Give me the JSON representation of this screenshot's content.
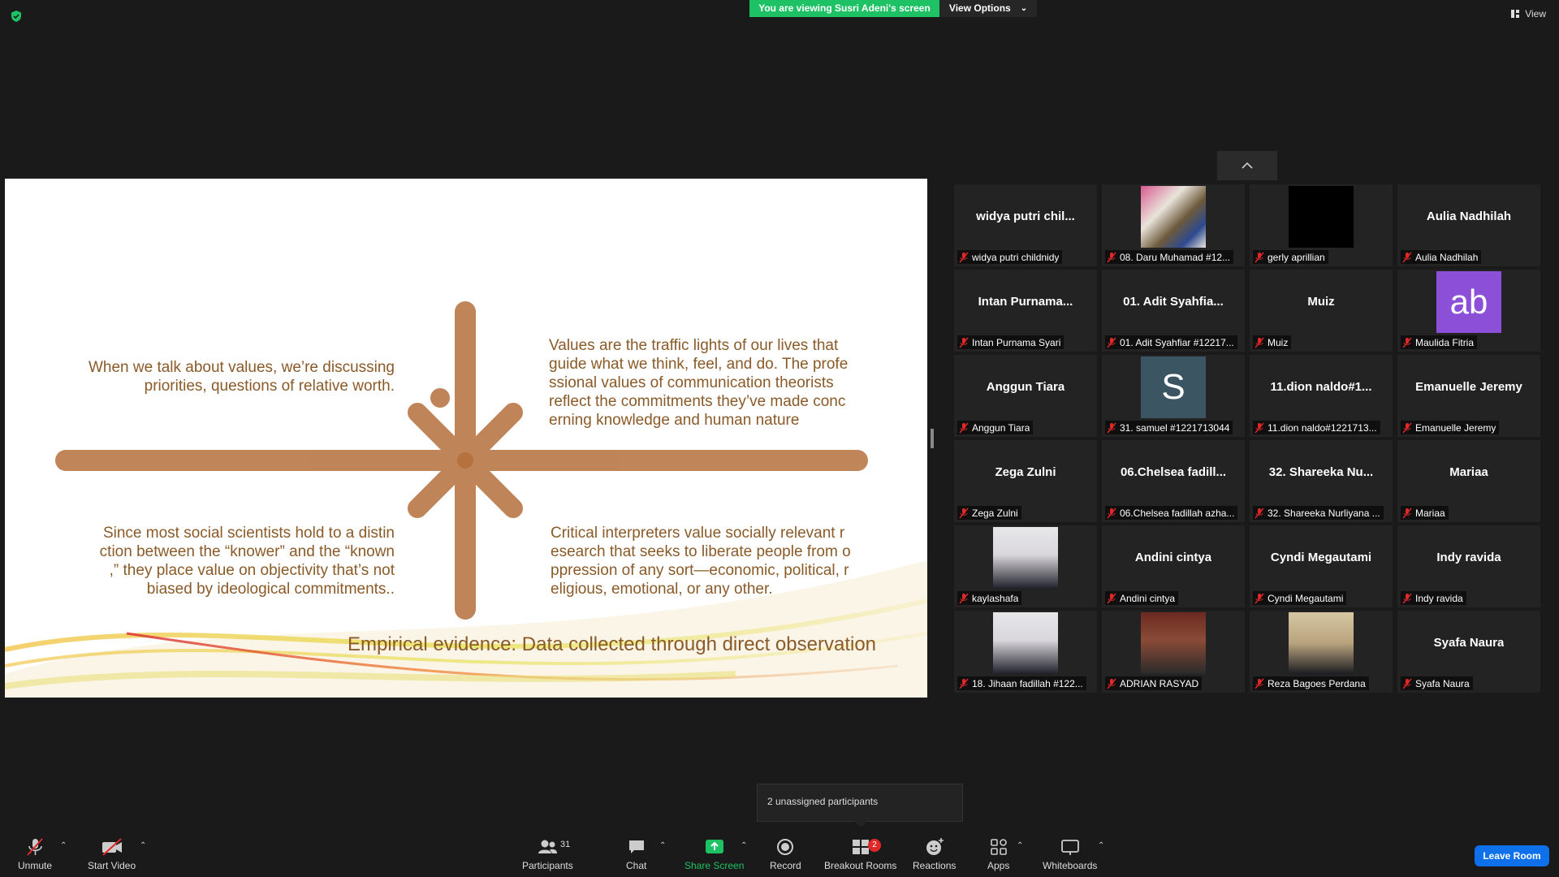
{
  "top_bar": {
    "banner": "You are viewing Susri Adeni's screen",
    "view_options": "View Options",
    "view": "View"
  },
  "slide": {
    "quadrant_top_left": "When we talk about values, we’re discussing priorities, questions of relative worth.",
    "quadrant_top_right": "Values are the traffic lights of our lives that guide what we think, feel, and do. The profe ssional values of communication theorists reflect the commitments they’ve made conc erning knowledge and human nature",
    "quadrant_bottom_left": "Since most social scientists hold to a distin ction between the “knower” and the “known ,” they place value on objectivity that’s not biased by ideological commitments..",
    "quadrant_bottom_right": "Critical interpreters value socially relevant r esearch that seeks to liberate people from o ppression of any sort—economic, political, r eligious, emotional, or any other.",
    "footer": "Empirical evidence: Data collected through direct observation",
    "accent_color": "#b5703c"
  },
  "gallery": {
    "tiles": [
      {
        "big": "widya  putri  chil...",
        "label": "widya putri childnidy"
      },
      {
        "big": "",
        "label": "08. Daru Muhamad #12..."
      },
      {
        "big": "",
        "label": "gerly aprillian"
      },
      {
        "big": "Aulia Nadhilah",
        "label": "Aulia Nadhilah"
      },
      {
        "big": "Intan  Purnama...",
        "label": "Intan Purnama Syari"
      },
      {
        "big": "01.  Adit  Syahfia...",
        "label": "01. Adit Syahfiar #12217..."
      },
      {
        "big": "Muiz",
        "label": "Muiz"
      },
      {
        "big": "ab",
        "label": "Maulida Fitria"
      },
      {
        "big": "Anggun Tiara",
        "label": "Anggun Tiara"
      },
      {
        "big": "S",
        "label": "31. samuel #1221713044"
      },
      {
        "big": "11.dion  naldo#1...",
        "label": "11.dion naldo#1221713..."
      },
      {
        "big": "Emanuelle Jeremy",
        "label": "Emanuelle Jeremy"
      },
      {
        "big": "Zega Zulni",
        "label": "Zega Zulni"
      },
      {
        "big": "06.Chelsea  fadill...",
        "label": "06.Chelsea fadillah azha..."
      },
      {
        "big": "32.  Shareeka  Nu...",
        "label": "32. Shareeka Nurliyana ..."
      },
      {
        "big": "Mariaa",
        "label": "Mariaa"
      },
      {
        "big": "",
        "label": "kaylashafa"
      },
      {
        "big": "Andini cintya",
        "label": "Andini cintya"
      },
      {
        "big": "Cyndi Megautami",
        "label": "Cyndi Megautami"
      },
      {
        "big": "Indy ravida",
        "label": "Indy ravida"
      },
      {
        "big": "",
        "label": "18. Jihaan fadillah #122..."
      },
      {
        "big": "",
        "label": "ADRIAN RASYAD"
      },
      {
        "big": "",
        "label": "Reza Bagoes Perdana"
      },
      {
        "big": "Syafa Naura",
        "label": "Syafa Naura"
      }
    ]
  },
  "popup": {
    "unassigned": "2 unassigned participants"
  },
  "toolbar": {
    "unmute": "Unmute",
    "start_video": "Start Video",
    "participants": "Participants",
    "participants_count": "31",
    "chat": "Chat",
    "share_screen": "Share Screen",
    "record": "Record",
    "breakout_rooms": "Breakout Rooms",
    "breakout_badge": "2",
    "reactions": "Reactions",
    "apps": "Apps",
    "whiteboards": "Whiteboards",
    "leave_room": "Leave Room"
  }
}
